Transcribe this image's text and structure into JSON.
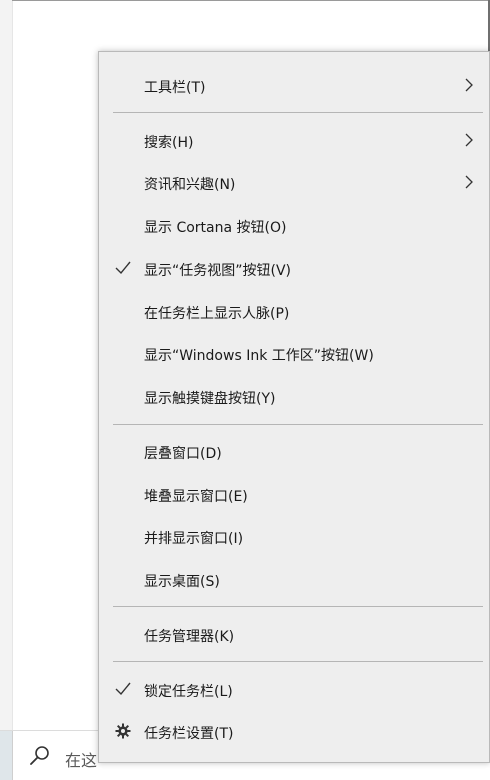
{
  "menu": {
    "items": [
      {
        "label": "工具栏(T)",
        "submenu": true
      },
      {
        "label": "搜索(H)",
        "submenu": true
      },
      {
        "label": "资讯和兴趣(N)",
        "submenu": true
      },
      {
        "label": "显示 Cortana 按钮(O)"
      },
      {
        "label": "显示“任务视图”按钮(V)",
        "checked": true
      },
      {
        "label": "在任务栏上显示人脉(P)"
      },
      {
        "label": "显示“Windows Ink 工作区”按钮(W)"
      },
      {
        "label": "显示触摸键盘按钮(Y)"
      },
      {
        "label": "层叠窗口(D)"
      },
      {
        "label": "堆叠显示窗口(E)"
      },
      {
        "label": "并排显示窗口(I)"
      },
      {
        "label": "显示桌面(S)"
      },
      {
        "label": "任务管理器(K)"
      },
      {
        "label": "锁定任务栏(L)",
        "checked": true
      },
      {
        "label": "任务栏设置(T)",
        "icon": "gear-icon"
      }
    ]
  },
  "taskbar": {
    "search_text": "在这"
  },
  "colors": {
    "menu_bg": "#eeeeee",
    "separator": "#b5b5b5",
    "text": "#1a1a1a"
  }
}
